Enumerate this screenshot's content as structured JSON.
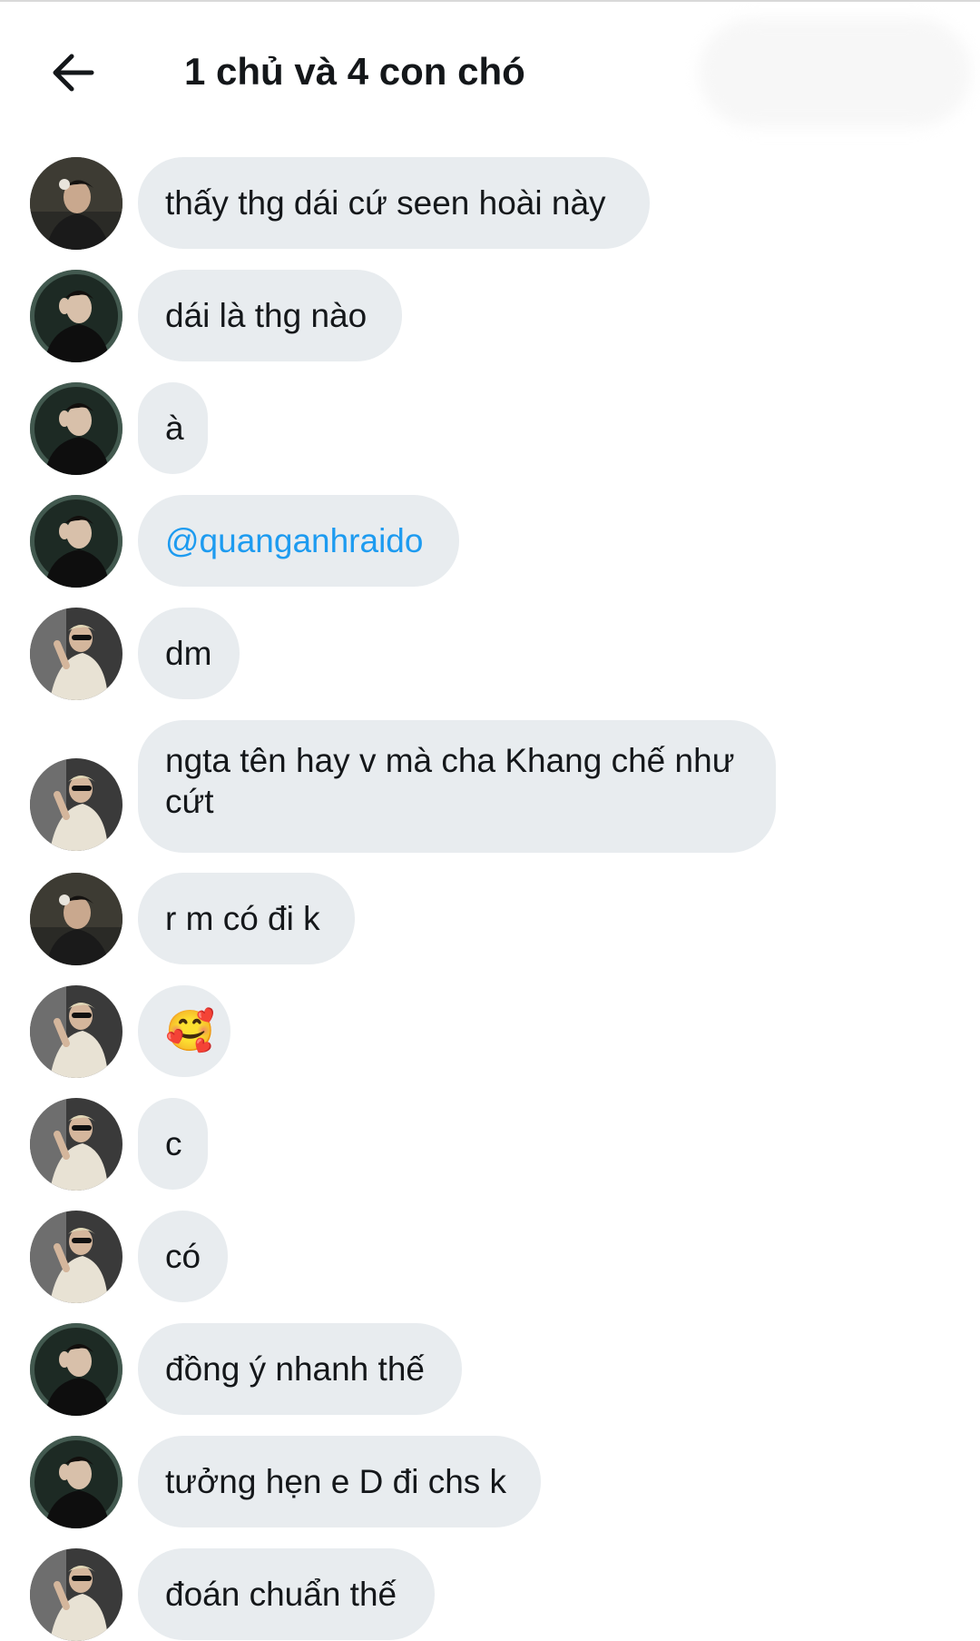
{
  "header": {
    "title": "1 chủ và 4 con chó",
    "back_icon": "arrow-left-icon"
  },
  "colors": {
    "bubble_bg": "#e8ecef",
    "mention": "#1d9bf0",
    "text": "#14171a"
  },
  "messages": [
    {
      "avatar": "avatar-a",
      "text": "thấy thg dái cứ seen hoài này"
    },
    {
      "avatar": "avatar-b",
      "text": "dái là thg nào"
    },
    {
      "avatar": "avatar-b",
      "text": "à"
    },
    {
      "avatar": "avatar-b",
      "text": "@quanganhraido",
      "type": "mention"
    },
    {
      "avatar": "avatar-c",
      "text": "dm"
    },
    {
      "avatar": "avatar-c",
      "text": "ngta tên hay v mà cha Khang chế như cứt"
    },
    {
      "avatar": "avatar-a",
      "text": "r m có đi k"
    },
    {
      "avatar": "avatar-c",
      "text": "🥰",
      "type": "emoji"
    },
    {
      "avatar": "avatar-c",
      "text": "c"
    },
    {
      "avatar": "avatar-c",
      "text": "có"
    },
    {
      "avatar": "avatar-b",
      "text": "đồng ý nhanh thế"
    },
    {
      "avatar": "avatar-b",
      "text": "tưởng hẹn e D đi chs k"
    },
    {
      "avatar": "avatar-c",
      "text": "đoán chuẩn thế"
    }
  ]
}
